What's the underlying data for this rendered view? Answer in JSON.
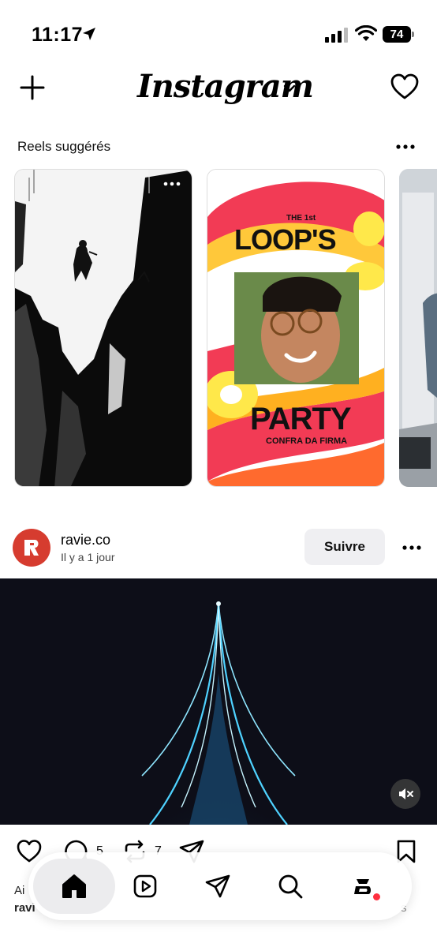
{
  "status_bar": {
    "time": "11:17",
    "battery": "74",
    "icons": [
      "location-arrow-icon",
      "signal-icon",
      "wifi-icon",
      "battery-icon"
    ]
  },
  "header": {
    "logo": "Instagram",
    "icons": [
      "plus-icon",
      "chevron-down-icon",
      "heart-icon"
    ]
  },
  "reels": {
    "title": "Reels suggérés",
    "items": [
      {
        "name": "reel-1"
      },
      {
        "name": "reel-2",
        "overlay_small": "THE 1st",
        "overlay_title": "LOOP'S",
        "overlay_party": "PARTY",
        "overlay_sub": "CONFRA DA FIRMA"
      },
      {
        "name": "reel-3"
      }
    ]
  },
  "post": {
    "username": "ravie.co",
    "time": "Il y a 1 jour",
    "follow_label": "Suivre",
    "comments_count": "5",
    "reposts_count": "7",
    "caption_prefix": "Ai",
    "caption_user": "ravi",
    "caption_end": "s"
  },
  "tabbar": {
    "items": [
      "home",
      "reels",
      "messages",
      "search",
      "profile"
    ]
  },
  "colors": {
    "avatar": "#d63c2f",
    "notification_dot": "#ff3040",
    "media_bg": "#0d0e18",
    "glow": "#4fd2ff"
  }
}
